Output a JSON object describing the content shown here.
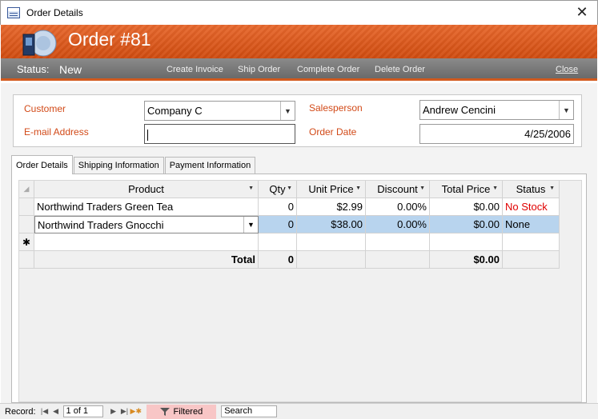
{
  "window": {
    "title": "Order Details"
  },
  "header": {
    "order_title": "Order #81"
  },
  "status": {
    "label": "Status:",
    "value": "New",
    "commands": [
      "Create Invoice",
      "Ship Order",
      "Complete Order",
      "Delete Order"
    ],
    "close": "Close"
  },
  "form": {
    "customer_label": "Customer",
    "customer_value": "Company C",
    "email_label": "E-mail Address",
    "email_value": "",
    "salesperson_label": "Salesperson",
    "salesperson_value": "Andrew Cencini",
    "order_date_label": "Order Date",
    "order_date_value": "4/25/2006"
  },
  "tabs": [
    "Order Details",
    "Shipping Information",
    "Payment Information"
  ],
  "grid": {
    "columns": [
      "Product",
      "Qty",
      "Unit Price",
      "Discount",
      "Total Price",
      "Status"
    ],
    "rows": [
      {
        "product": "Northwind Traders Green Tea",
        "qty": "0",
        "unit_price": "$2.99",
        "discount": "0.00%",
        "total_price": "$0.00",
        "status": "No Stock"
      },
      {
        "product": "Northwind Traders Gnocchi",
        "qty": "0",
        "unit_price": "$38.00",
        "discount": "0.00%",
        "total_price": "$0.00",
        "status": "None"
      }
    ],
    "new_row_marker": "✱",
    "total_label": "Total",
    "total_qty": "0",
    "total_price": "$0.00"
  },
  "record_nav": {
    "label": "Record:",
    "position": "1 of 1",
    "filter_label": "Filtered",
    "search_placeholder": "Search"
  },
  "colors": {
    "accent": "#d9561c",
    "status_red": "#e00000",
    "selected_row": "#b8d4ee"
  }
}
